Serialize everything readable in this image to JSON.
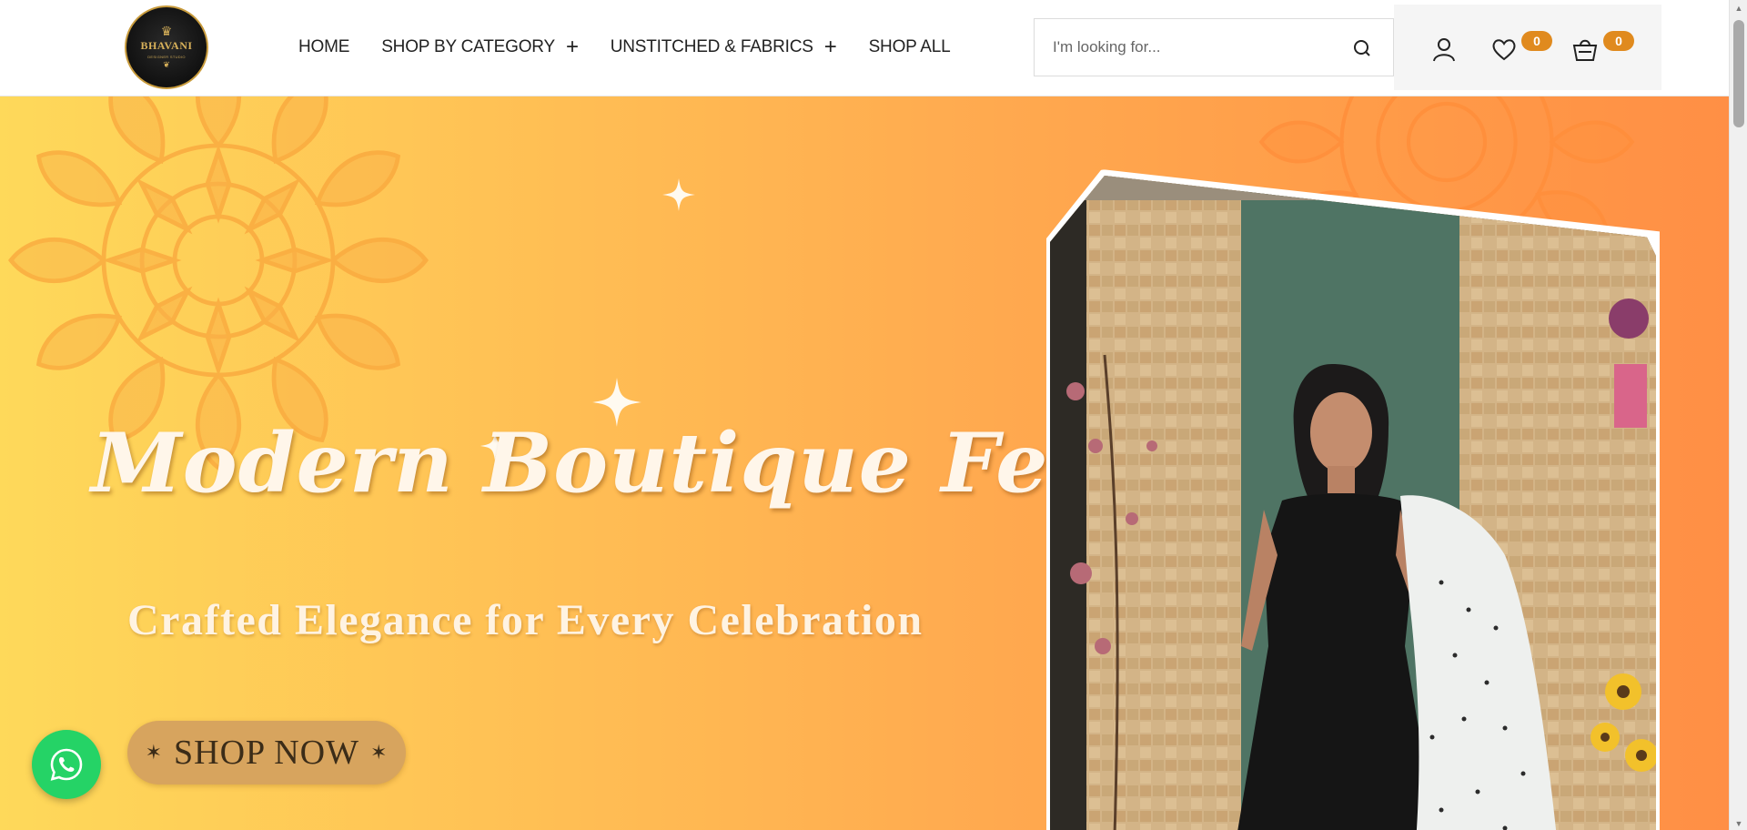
{
  "logo": {
    "brand": "BHAVANI",
    "tagline": "DESIGNER STUDIO",
    "icon": "crown-icon"
  },
  "nav": {
    "items": [
      {
        "label": "HOME",
        "has_submenu": false
      },
      {
        "label": "SHOP BY CATEGORY",
        "has_submenu": true
      },
      {
        "label": "UNSTITCHED & FABRICS",
        "has_submenu": true
      },
      {
        "label": "SHOP ALL",
        "has_submenu": false
      }
    ],
    "submenu_symbol": "+"
  },
  "search": {
    "placeholder": "I'm looking for...",
    "value": "",
    "icon": "search-icon"
  },
  "header_icons": {
    "account_icon": "user-icon",
    "wishlist_icon": "heart-icon",
    "wishlist_count": "0",
    "cart_icon": "basket-icon",
    "cart_count": "0",
    "badge_color": "#e08a1e"
  },
  "hero": {
    "headline": "Modern Boutique Feel",
    "subheadline": "Crafted Elegance for Every Celebration",
    "cta_label": "SHOP NOW",
    "cta_ornament": "✶",
    "gradient_colors": [
      "#fed95a",
      "#ffa94f",
      "#ff8f45"
    ],
    "button_color": "#d7a45e"
  },
  "floating": {
    "whatsapp_icon": "whatsapp-icon"
  }
}
